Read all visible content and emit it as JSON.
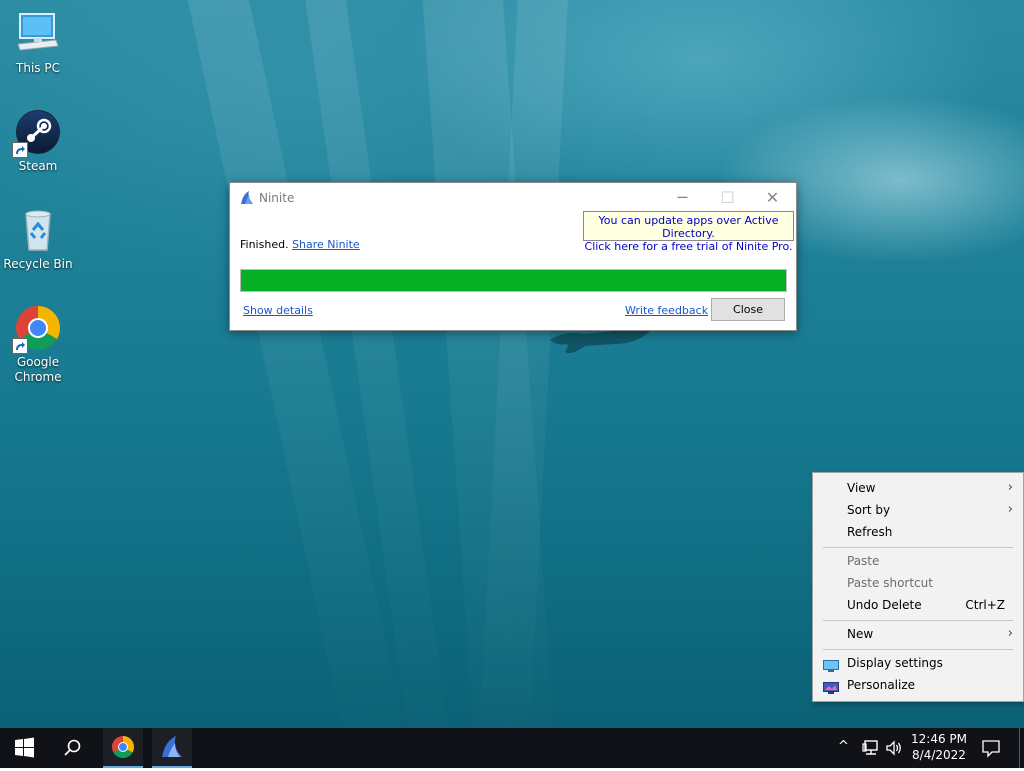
{
  "desktop": {
    "icons": [
      {
        "label": "This PC"
      },
      {
        "label": "Steam"
      },
      {
        "label": "Recycle Bin"
      },
      {
        "label": "Google Chrome"
      }
    ]
  },
  "ninite": {
    "title": "Ninite",
    "ad_line1": "You can update apps over Active Directory.",
    "ad_line2": "Click here for a free trial of Ninite Pro.",
    "status_text": "Finished.",
    "share_link": "Share Ninite",
    "progress_percent": 100,
    "progress_color": "#06b025",
    "show_details": "Show details",
    "write_feedback": "Write feedback",
    "close_button": "Close",
    "controls": {
      "minimize": "─",
      "maximize": "☐",
      "close": "✕"
    }
  },
  "context_menu": {
    "view": "View",
    "sort_by": "Sort by",
    "refresh": "Refresh",
    "paste": "Paste",
    "paste_shortcut": "Paste shortcut",
    "undo_delete": "Undo Delete",
    "undo_delete_accel": "Ctrl+Z",
    "new": "New",
    "display_settings": "Display settings",
    "personalize": "Personalize",
    "submenu_arrow": "›"
  },
  "taskbar": {
    "time": "12:46 PM",
    "date": "8/4/2022",
    "tray_chevron": "^",
    "pinned": [
      "start-icon",
      "search-icon",
      "chrome-icon",
      "ninite-icon"
    ]
  },
  "colors": {
    "accent": "#0078d7",
    "taskbar": "#101217",
    "link": "#1a56c9"
  }
}
